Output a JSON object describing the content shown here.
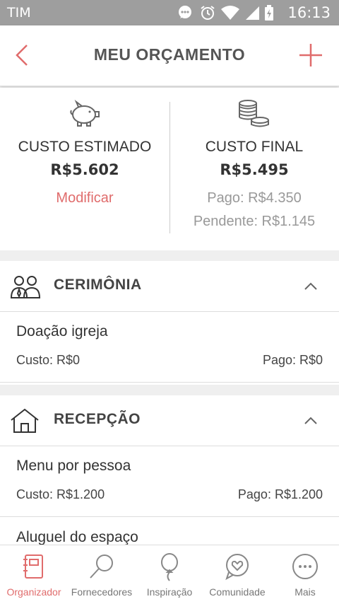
{
  "status_bar": {
    "carrier": "TIM",
    "time": "16:13"
  },
  "header": {
    "title": "MEU ORÇAMENTO"
  },
  "summary": {
    "estimated": {
      "label": "CUSTO ESTIMADO",
      "amount": "R$5.602",
      "action": "Modificar"
    },
    "final": {
      "label": "CUSTO FINAL",
      "amount": "R$5.495",
      "paid": "Pago: R$4.350",
      "pending": "Pendente: R$1.145"
    }
  },
  "sections": [
    {
      "title": "CERIMÔNIA",
      "items": [
        {
          "name": "Doação igreja",
          "cost": "Custo: R$0",
          "paid": "Pago: R$0"
        }
      ]
    },
    {
      "title": "RECEPÇÃO",
      "items": [
        {
          "name": "Menu por pessoa",
          "cost": "Custo: R$1.200",
          "paid": "Pago: R$1.200"
        },
        {
          "name": "Aluguel do espaço",
          "cost": "",
          "paid": ""
        }
      ]
    }
  ],
  "bottom_nav": [
    {
      "label": "Organizador",
      "icon": "notebook-icon",
      "active": true
    },
    {
      "label": "Fornecedores",
      "icon": "magnifier-icon",
      "active": false
    },
    {
      "label": "Inspiração",
      "icon": "balloon-icon",
      "active": false
    },
    {
      "label": "Comunidade",
      "icon": "heart-chat-icon",
      "active": false
    },
    {
      "label": "Mais",
      "icon": "more-icon",
      "active": false
    }
  ],
  "colors": {
    "accent": "#e06c6c",
    "text": "#333333",
    "muted": "#999999"
  }
}
